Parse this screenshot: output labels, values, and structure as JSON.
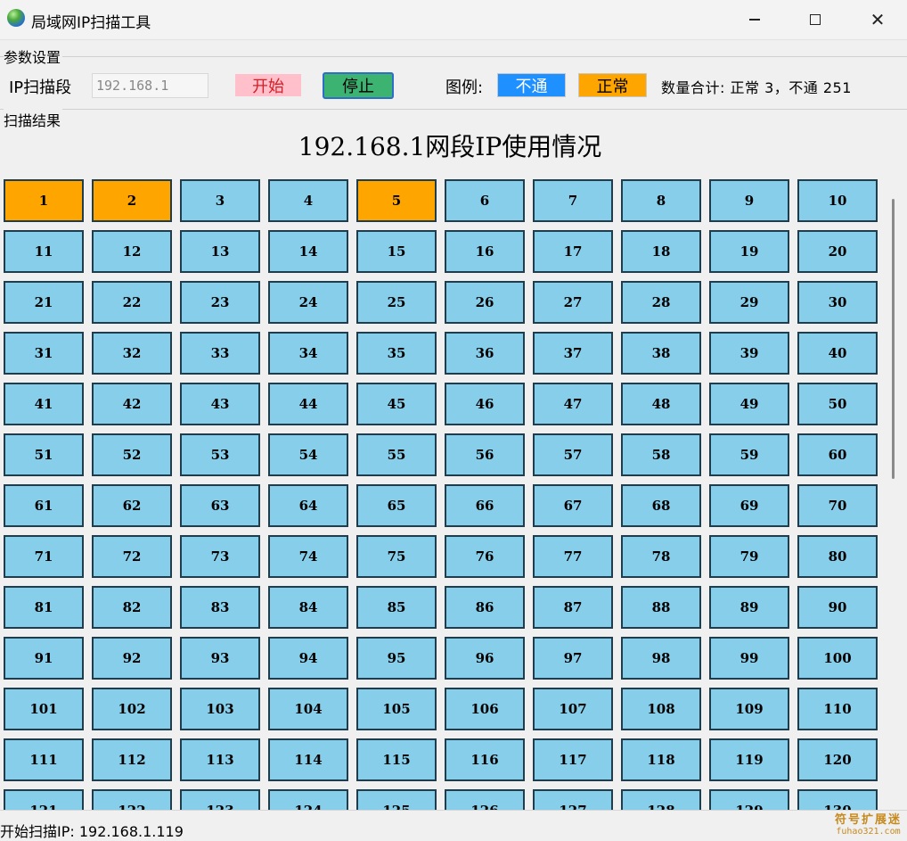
{
  "window": {
    "title": "局域网IP扫描工具"
  },
  "params": {
    "group_label": "参数设置",
    "ip_label": "IP扫描段",
    "ip_value": "192.168.1",
    "start_label": "开始",
    "stop_label": "停止",
    "legend_label": "图例:",
    "legend_unreachable": "不通",
    "legend_normal": "正常",
    "summary": "数量合计: 正常 3，不通 251"
  },
  "results": {
    "group_label": "扫描结果",
    "title": "192.168.1网段IP使用情况",
    "normal_ips": [
      1,
      2,
      5
    ],
    "total_cells": 130,
    "columns": 10,
    "colors": {
      "normal": "#ffa500",
      "unreachable": "#87ceeb"
    }
  },
  "status": {
    "text": "开始扫描IP: 192.168.1.119"
  },
  "watermark": {
    "line1": "符号扩展迷",
    "line2": "fuhao321.com"
  }
}
